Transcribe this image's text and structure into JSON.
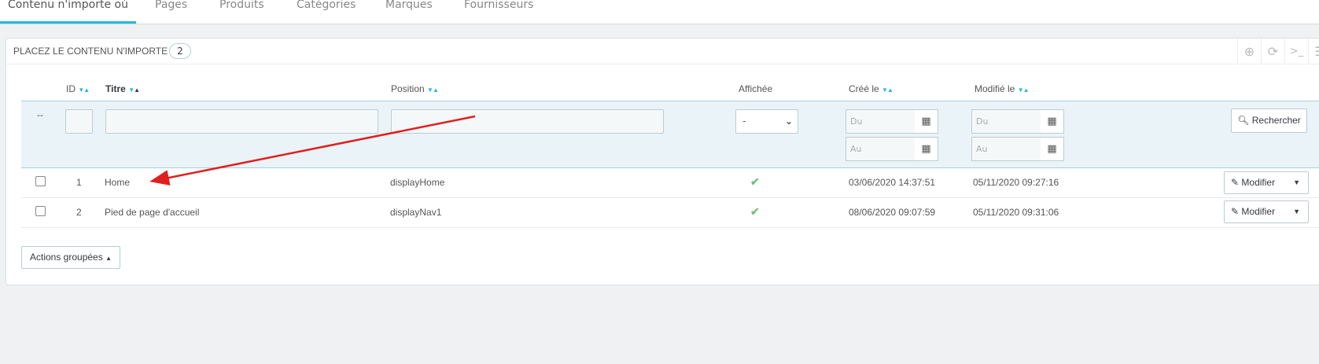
{
  "tabs": [
    {
      "label": "Contenu n'importe où",
      "active": true
    },
    {
      "label": "Pages"
    },
    {
      "label": "Produits"
    },
    {
      "label": "Catégories"
    },
    {
      "label": "Marques"
    },
    {
      "label": "Fournisseurs"
    }
  ],
  "panel": {
    "title": "PLACEZ LE CONTENU N'IMPORTE OÙ",
    "count": "2",
    "tools": [
      "plus-circle-icon",
      "refresh-icon",
      "terminal-icon",
      "database-icon"
    ]
  },
  "columns": {
    "id": "ID",
    "titre": "Titre",
    "position": "Position",
    "affichee": "Affichée",
    "cree": "Créé le",
    "modifie": "Modifié le"
  },
  "filters": {
    "bulk": "--",
    "select_value": "-",
    "from_placeholder": "Du",
    "to_placeholder": "Au",
    "search_label": "Rechercher"
  },
  "rows": [
    {
      "id": "1",
      "title": "Home",
      "position": "displayHome",
      "created": "03/06/2020 14:37:51",
      "modified": "05/11/2020 09:27:16",
      "edit": "Modifier"
    },
    {
      "id": "2",
      "title": "Pied de page d'accueil",
      "position": "displayNav1",
      "created": "08/06/2020 09:07:59",
      "modified": "05/11/2020 09:31:06",
      "edit": "Modifier"
    }
  ],
  "bulk_actions": "Actions groupées",
  "colors": {
    "accent": "#25b9d7",
    "check": "#72c279",
    "annotation_arrow": "#e02020"
  }
}
